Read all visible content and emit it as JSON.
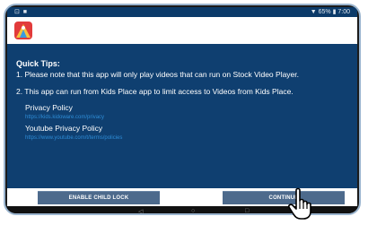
{
  "status_bar": {
    "left": "⊡ ■",
    "right": "▼ 65% ▮ 7:00"
  },
  "content": {
    "tips_title": "Quick Tips:",
    "tip1": "1. Please note that this app will only play videos that can run on Stock Video Player.",
    "tip2": "2. This app can run from Kids Place app to limit access to Videos from Kids Place.",
    "privacy_policy_title": "Privacy Policy",
    "privacy_policy_link": "https://kids.kidoware.com/privacy",
    "youtube_privacy_policy_title": "Youtube Privacy Policy",
    "youtube_privacy_policy_link": "https://www.youtube.com/t/terms/policies"
  },
  "buttons": {
    "enable_child_lock": "ENABLE CHILD LOCK",
    "continue": "CONTINUE"
  },
  "nav": {
    "back": "◁",
    "home": "○",
    "recent": "□"
  },
  "icons": {
    "app": "kids-place-app-icon",
    "cursor": "hand-pointer-cursor"
  }
}
